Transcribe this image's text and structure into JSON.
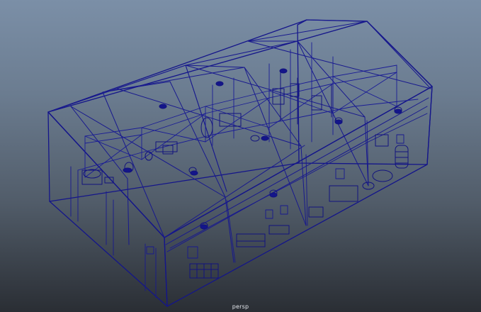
{
  "viewport": {
    "camera_label": "persp",
    "display_mode": "wireframe",
    "wire_color": "#14158a",
    "wire_color_light": "#2224a6",
    "background_top": "#7b8fa7",
    "background_bottom": "#2a2e34"
  },
  "model": {
    "kind": "warehouse-building",
    "roof": "gable",
    "bays": 4
  }
}
